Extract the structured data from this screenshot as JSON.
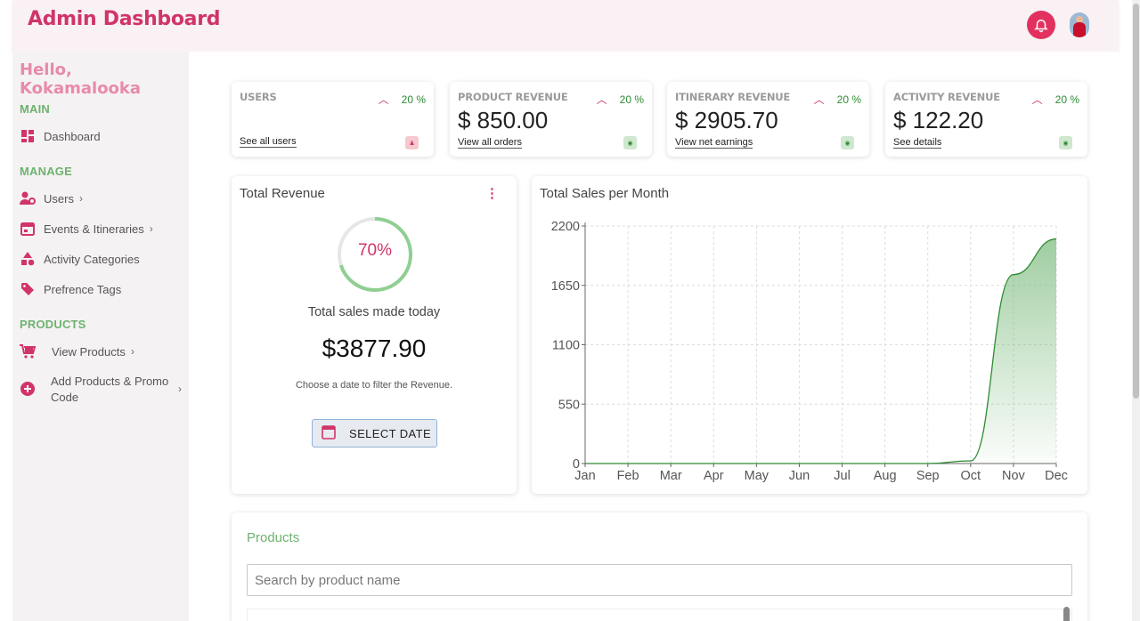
{
  "header": {
    "title": "Admin Dashboard",
    "bell_icon": "bell-icon",
    "accent": "#e2315f"
  },
  "sidebar": {
    "greeting": "Hello, Kokamalooka",
    "sections": {
      "main": "MAIN",
      "manage": "MANAGE",
      "products": "PRODUCTS"
    },
    "items": [
      {
        "label": "Dashboard",
        "icon": "dashboard-icon"
      },
      {
        "label": "Users",
        "icon": "users-cog-icon",
        "chevron": "›"
      },
      {
        "label": "Events & Itineraries",
        "icon": "calendar-icon",
        "chevron": "›"
      },
      {
        "label": "Activity Categories",
        "icon": "shapes-icon"
      },
      {
        "label": "Prefrence Tags",
        "icon": "tags-icon"
      },
      {
        "label": "View Products",
        "icon": "cart-icon",
        "chevron": "›"
      },
      {
        "label": "Add Products & Promo Code",
        "icon": "plus-circle-icon",
        "chevron": "›"
      }
    ]
  },
  "stats": [
    {
      "title": "USERS",
      "percent": "20 %",
      "value": "",
      "link": "See all users",
      "badge_color": "#f6c9cf"
    },
    {
      "title": "PRODUCT REVENUE",
      "percent": "20 %",
      "value": "$ 850.00",
      "link": "View all orders",
      "badge_color": "#cfe8cf"
    },
    {
      "title": "ITINERARY REVENUE",
      "percent": "20 %",
      "value": "$ 2905.70",
      "link": "View net earnings",
      "badge_color": "#cfe8cf"
    },
    {
      "title": "ACTIVITY REVENUE",
      "percent": "20 %",
      "value": "$ 122.20",
      "link": "See details",
      "badge_color": "#cfe8cf"
    }
  ],
  "revenue": {
    "title": "Total Revenue",
    "progress_label": "70%",
    "progress": 0.7,
    "subtitle": "Total sales made today",
    "amount": "$3877.90",
    "hint": "Choose a date to filter the Revenue.",
    "button_label": "SELECT DATE"
  },
  "chart_data": {
    "type": "area",
    "title": "Total Sales per Month",
    "categories": [
      "Jan",
      "Feb",
      "Mar",
      "Apr",
      "May",
      "Jun",
      "Jul",
      "Aug",
      "Sep",
      "Oct",
      "Nov",
      "Dec"
    ],
    "values": [
      0,
      0,
      0,
      0,
      0,
      0,
      0,
      0,
      0,
      25,
      1750,
      2080
    ],
    "ylim": [
      0,
      2200
    ],
    "yticks": [
      0,
      550,
      1100,
      1650,
      2200
    ],
    "grid": true,
    "color": "#2e8b32"
  },
  "products": {
    "title": "Products",
    "search_placeholder": "Search by product name"
  }
}
